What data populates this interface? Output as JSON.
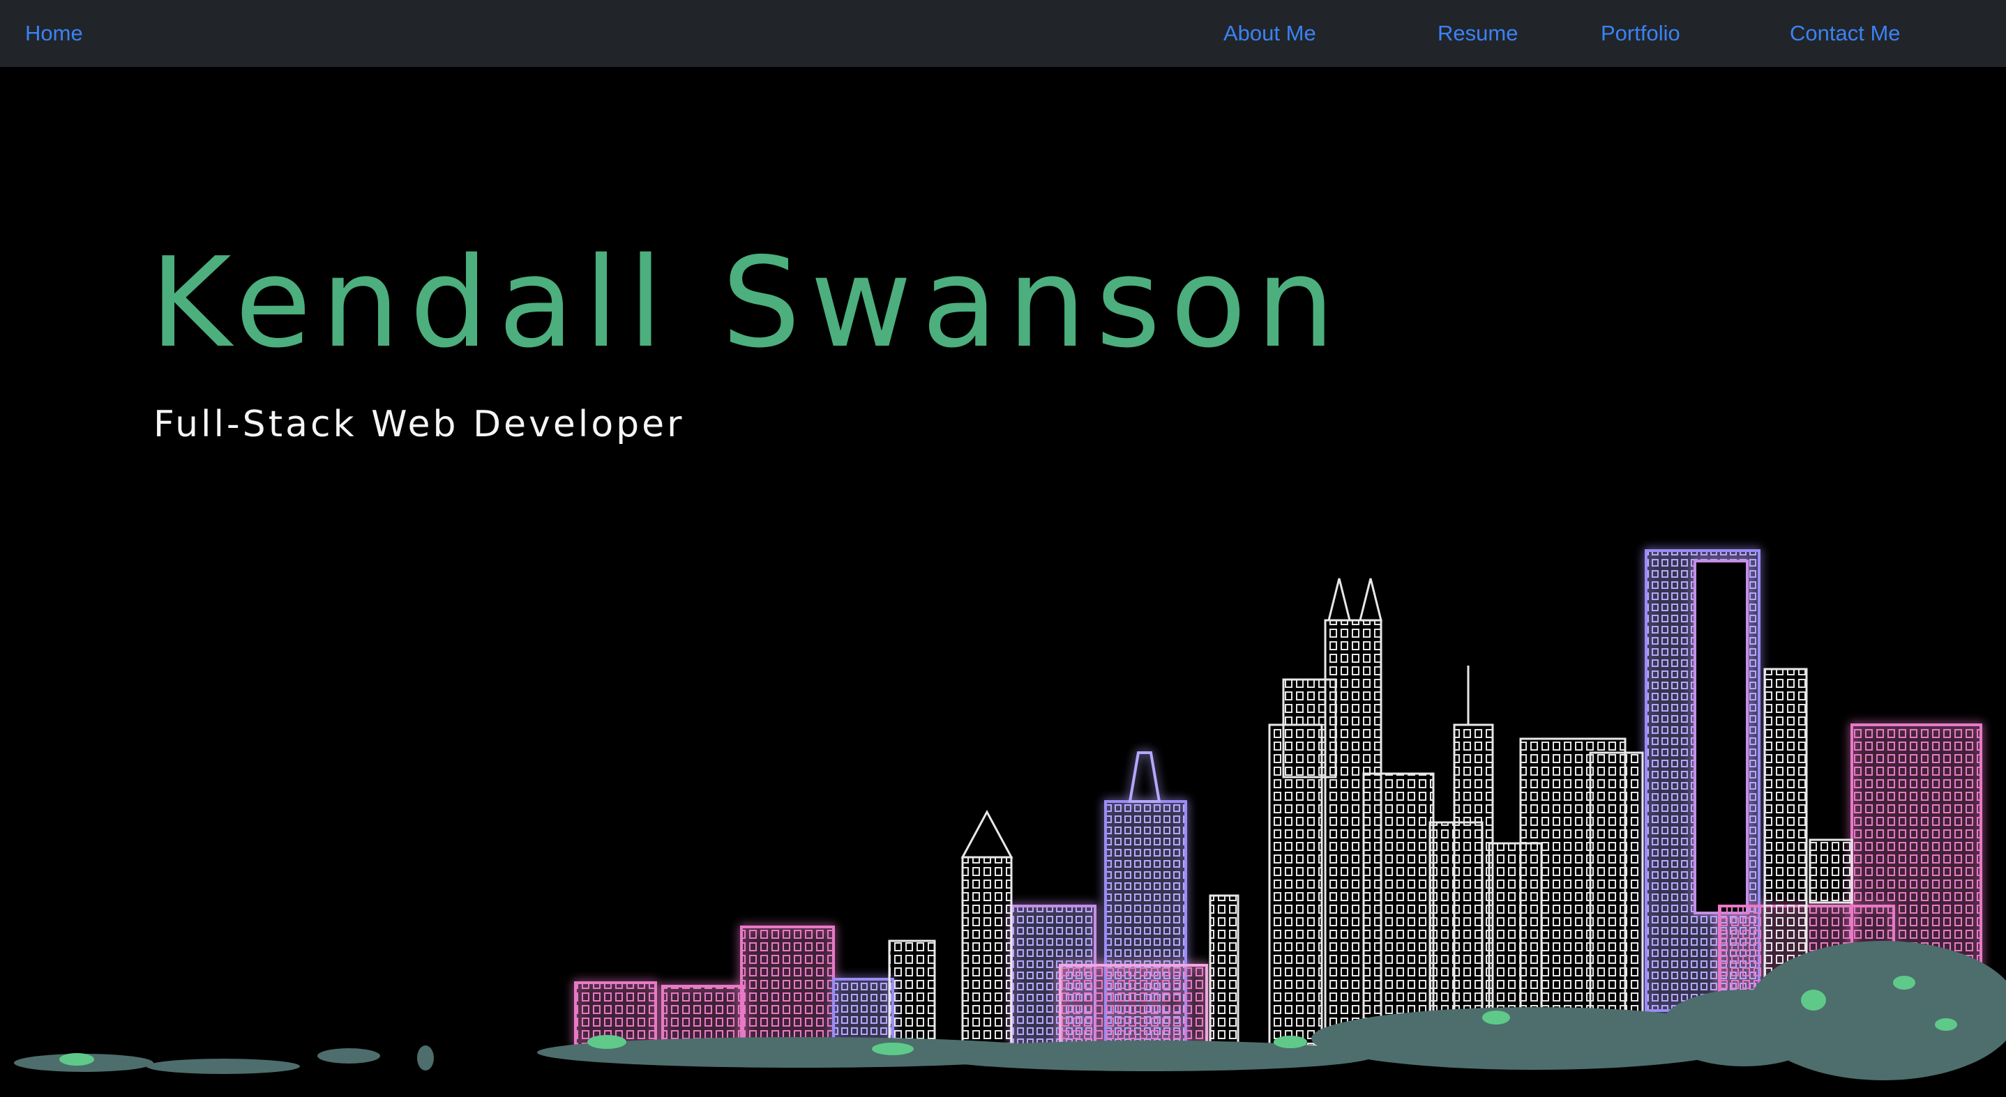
{
  "nav": {
    "home": "Home",
    "about": "About Me",
    "resume": "Resume",
    "portfolio": "Portfolio",
    "contact": "Contact Me"
  },
  "hero": {
    "name": "Kendall Swanson",
    "subtitle": "Full-Stack Web Developer"
  },
  "theme": {
    "navbar_bg": "#212529",
    "link_color": "#3b82f6",
    "name_color": "#4caf7d",
    "subtitle_color": "#f5f5f5",
    "page_bg": "#000000",
    "neon_pink": "#e879c6",
    "neon_violet": "#9b8cf5",
    "outline_white": "#e8e8e8",
    "foliage_teal": "#4d6e6c",
    "foliage_green": "#5fc98a"
  },
  "background_image": "neon-city-skyline"
}
